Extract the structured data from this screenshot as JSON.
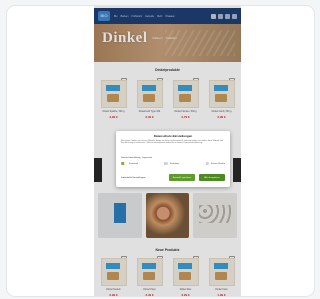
{
  "nav": {
    "logo_text": "BIO",
    "links": [
      "Bio",
      "Backen",
      "Frühstück",
      "Getreide",
      "Mehl",
      "Ölsaaten",
      "Hülsenfrüchte",
      "Rezepte"
    ]
  },
  "hero": {
    "title": "Dinkel",
    "subtitle": "Vollkorn · Tradition"
  },
  "sections": {
    "top_title": "Dinkelprodukte",
    "bottom_title": "Neue Produkte"
  },
  "top_products": [
    {
      "name": "Dinkel Spätzle, 500 g",
      "price": "3,99 €"
    },
    {
      "name": "Dinkelmehl Type 630",
      "price": "2,49 €"
    },
    {
      "name": "Dinkel Flocken, 500 g",
      "price": "2,79 €"
    },
    {
      "name": "Dinkel Grieß, 500 g",
      "price": "2,99 €"
    }
  ],
  "bottom_products": [
    {
      "name": "Dinkel Nudeln",
      "price": "2,99 €"
    },
    {
      "name": "Dinkel Pops",
      "price": "3,49 €"
    },
    {
      "name": "Dinkel Reis",
      "price": "3,29 €"
    },
    {
      "name": "Dinkel Keks",
      "price": "1,99 €"
    }
  ],
  "consent": {
    "title": "Datenschutz-Einstellungen",
    "text": "Wir nutzen Cookies auf unserer Website. Einige von ihnen sind essenziell, während andere uns helfen, diese Website und Ihre Erfahrung zu verbessern. Weitere Informationen finden Sie in unserer Datenschutzerklärung.",
    "link": "Datenschutzerklärung · Impressum",
    "toggles": [
      {
        "label": "Essenziell",
        "on": true
      },
      {
        "label": "Statistiken",
        "on": false
      },
      {
        "label": "Externe Medien",
        "on": false
      }
    ],
    "settings_label": "Individuelle Einstellungen",
    "save_selection_label": "Auswahl speichern",
    "accept_all_label": "Alle akzeptieren"
  },
  "colors": {
    "nav_bg": "#1f3f73",
    "accent_green": "#5f9a2e",
    "price_red": "#c62828"
  }
}
